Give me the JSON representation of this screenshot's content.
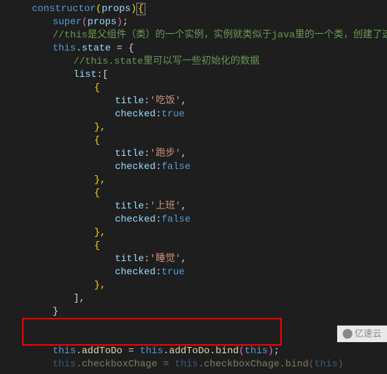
{
  "code": {
    "constructor": "constructor",
    "props": "props",
    "super": "super",
    "comment1": "//this是父组件（类）的一个实例，实例就类似于java里的一个类，创建了这",
    "this": "this",
    "state": "state",
    "eq_open": " = {",
    "comment2": "//this.state里可以写一些初始化的数据",
    "list": "list",
    "bracket_open": ":[",
    "open_brace": "{",
    "title": "title",
    "colon": ":",
    "item1_title": "'吃饭'",
    "comma": ",",
    "checked": "checked",
    "true": "true",
    "false": "false",
    "close_brace_comma": "},",
    "item2_title": "'跑步'",
    "item3_title": "'上班'",
    "item4_title": "'睡觉'",
    "bracket_close": "],",
    "close_brace": "}",
    "addToDo": "addToDo",
    "bind": "bind",
    "eq": " = ",
    "open_paren": "(",
    "close_paren": ")",
    "semi": ";",
    "checkboxChage": "checkboxChage",
    "dot": "."
  },
  "watermark": "亿速云"
}
